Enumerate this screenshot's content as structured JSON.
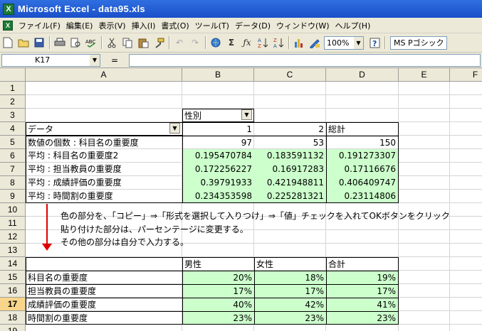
{
  "window": {
    "title": "Microsoft Excel - data95.xls",
    "app_icon": "X"
  },
  "menu": [
    "ファイル(F)",
    "編集(E)",
    "表示(V)",
    "挿入(I)",
    "書式(O)",
    "ツール(T)",
    "データ(D)",
    "ウィンドウ(W)",
    "ヘルプ(H)"
  ],
  "toolbar": {
    "zoom": "100%",
    "font": "MS Pゴシック"
  },
  "formula_bar": {
    "name_box": "K17",
    "equals": "=",
    "formula": ""
  },
  "columns": [
    "A",
    "B",
    "C",
    "D",
    "E",
    "F"
  ],
  "rows": [
    "1",
    "2",
    "3",
    "4",
    "5",
    "6",
    "7",
    "8",
    "9",
    "10",
    "11",
    "12",
    "13",
    "14",
    "15",
    "16",
    "17",
    "18",
    "19"
  ],
  "active_row": "17",
  "pivot": {
    "field_label": "性別",
    "data_label": "データ",
    "col1": "1",
    "col2": "2",
    "total_label": "総計",
    "rows": [
      {
        "label": "数値の個数 : 科目名の重要度",
        "b": "97",
        "c": "53",
        "d": "150"
      },
      {
        "label": "平均 : 科目名の重要度2",
        "b": "0.195470784",
        "c": "0.183591132",
        "d": "0.191273307"
      },
      {
        "label": "平均 : 担当教員の重要度",
        "b": "0.172256227",
        "c": "0.16917283",
        "d": "0.17116676"
      },
      {
        "label": "平均 : 成績評価の重要度",
        "b": "0.39791933",
        "c": "0.421948811",
        "d": "0.406409747"
      },
      {
        "label": "平均 : 時間割の重要度",
        "b": "0.234353598",
        "c": "0.225281321",
        "d": "0.23114806"
      }
    ]
  },
  "notes": [
    "色の部分を、「コピー」⇒「形式を選択して入りつけ」⇒「値」チェックを入れてOKボタンをクリック",
    "貼り付けた部分は、パーセンテージに変更する。",
    "その他の部分は自分で入力する。"
  ],
  "summary": {
    "headers": [
      "男性",
      "女性",
      "合計"
    ],
    "rows": [
      {
        "label": "科目名の重要度",
        "b": "20%",
        "c": "18%",
        "d": "19%"
      },
      {
        "label": "担当教員の重要度",
        "b": "17%",
        "c": "17%",
        "d": "17%"
      },
      {
        "label": "成績評価の重要度",
        "b": "40%",
        "c": "42%",
        "d": "41%"
      },
      {
        "label": "時間割の重要度",
        "b": "23%",
        "c": "23%",
        "d": "23%"
      }
    ]
  },
  "colors": {
    "highlight": "#ccffcc",
    "arrow": "#e00000",
    "titlebar": "#1a4fc9"
  },
  "icons": [
    "excel-app-icon",
    "new-icon",
    "open-icon",
    "save-icon",
    "print-icon",
    "print-preview-icon",
    "spelling-icon",
    "cut-icon",
    "copy-icon",
    "paste-icon",
    "format-painter-icon",
    "undo-icon",
    "redo-icon",
    "hyperlink-icon",
    "autosum-icon",
    "function-icon",
    "sort-ascending-icon",
    "sort-descending-icon",
    "chart-wizard-icon",
    "drawing-icon",
    "help-icon"
  ]
}
